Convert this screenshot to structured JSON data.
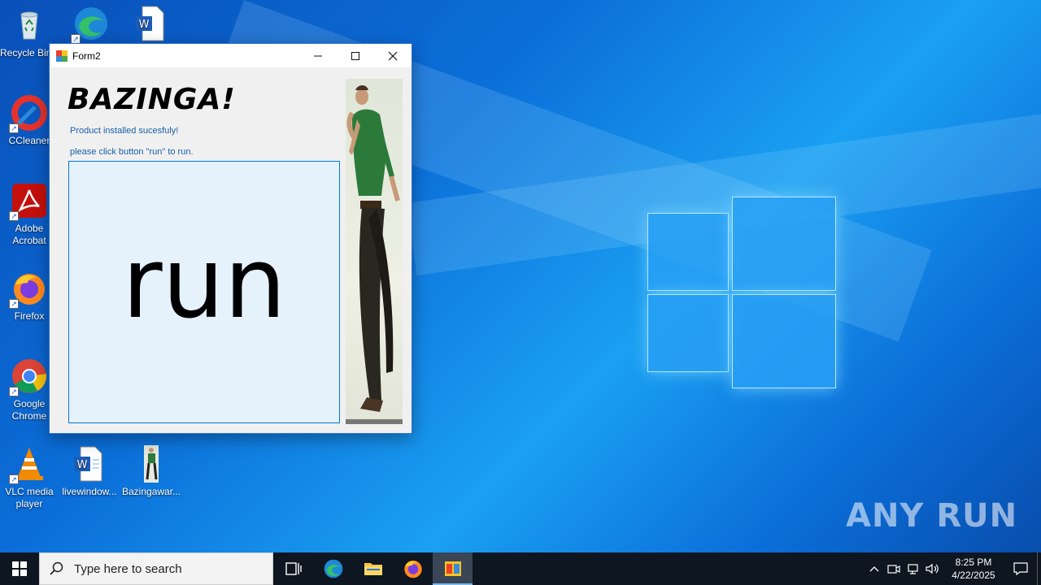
{
  "desktop": {
    "icons": [
      {
        "label": "Recycle Bin"
      },
      {
        "label": "CCleaner"
      },
      {
        "label": "Adobe Acrobat"
      },
      {
        "label": "Firefox"
      },
      {
        "label": "Google Chrome"
      },
      {
        "label": "VLC media player"
      },
      {
        "label": "livewindow..."
      },
      {
        "label": "Bazingawar..."
      }
    ]
  },
  "window": {
    "title": "Form2",
    "heading": "BAZINGA!",
    "line1": "Product installed sucesfuly!",
    "line2": "please click button \"run\" to run.",
    "run_button": "run"
  },
  "watermark": {
    "text": "ANY RUN"
  },
  "taskbar": {
    "search_placeholder": "Type here to search",
    "time": "8:25 PM",
    "date": "4/22/2025"
  }
}
